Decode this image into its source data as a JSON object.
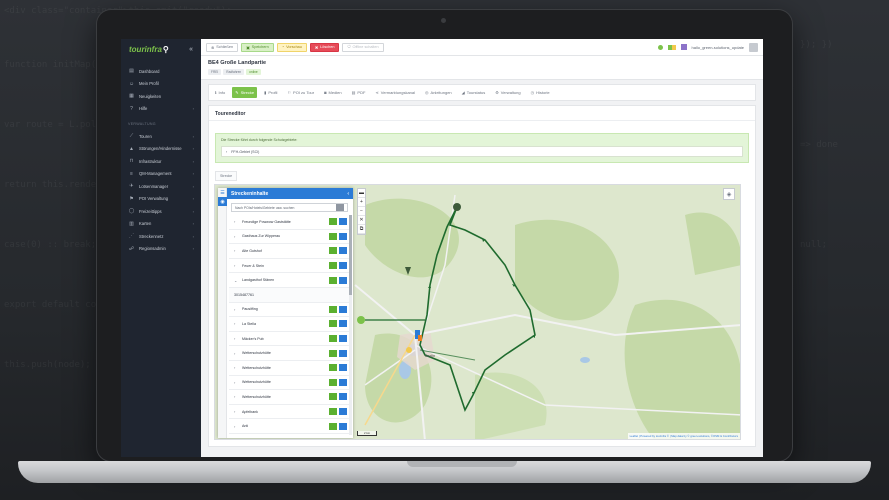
{
  "app": {
    "logo": "tourinfra",
    "page_title": "BE4 Große Landpartie",
    "badges": [
      "FREI",
      "Radfahren",
      "online"
    ]
  },
  "toolbar": {
    "buttons": [
      {
        "label": "Schließen",
        "icon": "close-circle-icon",
        "style": "default"
      },
      {
        "label": "Speichern",
        "icon": "save-icon",
        "style": "save"
      },
      {
        "label": "Vorschau",
        "icon": "preview-icon",
        "style": "preview"
      },
      {
        "label": "Löschen",
        "icon": "trash-icon",
        "style": "delete"
      },
      {
        "label": "Offline schalten",
        "icon": "power-icon",
        "style": "disabled"
      }
    ],
    "user": "hallo_green-solutions_update"
  },
  "sidebar": {
    "items": [
      {
        "label": "Dashboard",
        "icon": "dashboard-icon"
      },
      {
        "label": "Mein Profil",
        "icon": "user-icon"
      },
      {
        "label": "Neuigkeiten",
        "icon": "news-icon"
      },
      {
        "label": "Hilfe",
        "icon": "help-icon",
        "chevron": true
      }
    ],
    "section_header": "VERWALTUNG",
    "section_items": [
      {
        "label": "Touren",
        "icon": "route-icon",
        "chevron": true
      },
      {
        "label": "Störungen/Hindernisse",
        "icon": "warning-icon",
        "chevron": true
      },
      {
        "label": "Infrastruktur",
        "icon": "infrastructure-icon",
        "chevron": true
      },
      {
        "label": "QM-Management",
        "icon": "qm-icon",
        "chevron": true
      },
      {
        "label": "Lotsenmanager",
        "icon": "pilot-icon",
        "chevron": true
      },
      {
        "label": "POI Verwaltung",
        "icon": "poi-icon",
        "chevron": true
      },
      {
        "label": "Freizeittipps",
        "icon": "tips-icon",
        "chevron": true
      },
      {
        "label": "Karten",
        "icon": "map-icon",
        "chevron": true
      },
      {
        "label": "Streckennetz",
        "icon": "network-icon",
        "chevron": true
      },
      {
        "label": "Regionsadmin",
        "icon": "admin-icon",
        "chevron": true
      }
    ]
  },
  "tabs": [
    {
      "label": "Info",
      "icon": "info-icon",
      "active": false
    },
    {
      "label": "Strecke",
      "icon": "pencil-icon",
      "active": true
    },
    {
      "label": "Profil",
      "icon": "chart-icon",
      "active": false
    },
    {
      "label": "POI zu Tour",
      "icon": "poi-add-icon",
      "active": false
    },
    {
      "label": "Medien",
      "icon": "camera-icon",
      "active": false
    },
    {
      "label": "PDF",
      "icon": "pdf-icon",
      "active": false
    },
    {
      "label": "Vermarktungskanal",
      "icon": "share-icon",
      "active": false
    },
    {
      "label": "Anleitungen",
      "icon": "guide-icon",
      "active": false
    },
    {
      "label": "Tourstatus",
      "icon": "status-icon",
      "active": false
    },
    {
      "label": "Verwaltung",
      "icon": "gear-icon",
      "active": false
    },
    {
      "label": "Historie",
      "icon": "history-icon",
      "active": false
    }
  ],
  "editor": {
    "title": "Toureneditor",
    "alert_text": "Die Strecke führt durch folgende Schutzgebiete:",
    "alert_item": "FFH-Gebiet (SCI)",
    "sub_tab": "Strecke"
  },
  "map_panel": {
    "title": "Streckeninhalte",
    "search_placeholder": "Nach POIs/Hotels/Gebiete usw. suchen",
    "items": [
      {
        "label": "Freundige Powwow Gaststätte",
        "expanded": false
      },
      {
        "label": "Gasthaus Zur Wipperau",
        "expanded": false
      },
      {
        "label": "Alte Gutshof",
        "expanded": false
      },
      {
        "label": "Feuer & Stein",
        "expanded": false
      },
      {
        "label": "Landgasthof Stänen",
        "expanded": true
      },
      {
        "label": "3015487761",
        "sub": true
      },
      {
        "label": "Pausitfing",
        "expanded": false
      },
      {
        "label": "La Stella",
        "expanded": false
      },
      {
        "label": "Mäcker's Pub",
        "expanded": false
      },
      {
        "label": "Wetterschutzhütte",
        "expanded": false
      },
      {
        "label": "Wetterschutzhütte",
        "expanded": false
      },
      {
        "label": "Wetterschutzhütte",
        "expanded": false
      },
      {
        "label": "Wetterschutzhütte",
        "expanded": false
      },
      {
        "label": "Apfelbank",
        "expanded": false
      },
      {
        "label": "Anti",
        "expanded": false
      }
    ]
  },
  "map": {
    "attribution": "Leaflet | Powered by tourinfra © | Map data by © green-solutions, ©OSM & Contributors",
    "scale": "2 km",
    "town_label": "Berlin"
  },
  "colors": {
    "accent_green": "#7cc24a",
    "panel_blue": "#2b7bd6",
    "route": "#1f6b2e",
    "delete_red": "#e64b58"
  }
}
